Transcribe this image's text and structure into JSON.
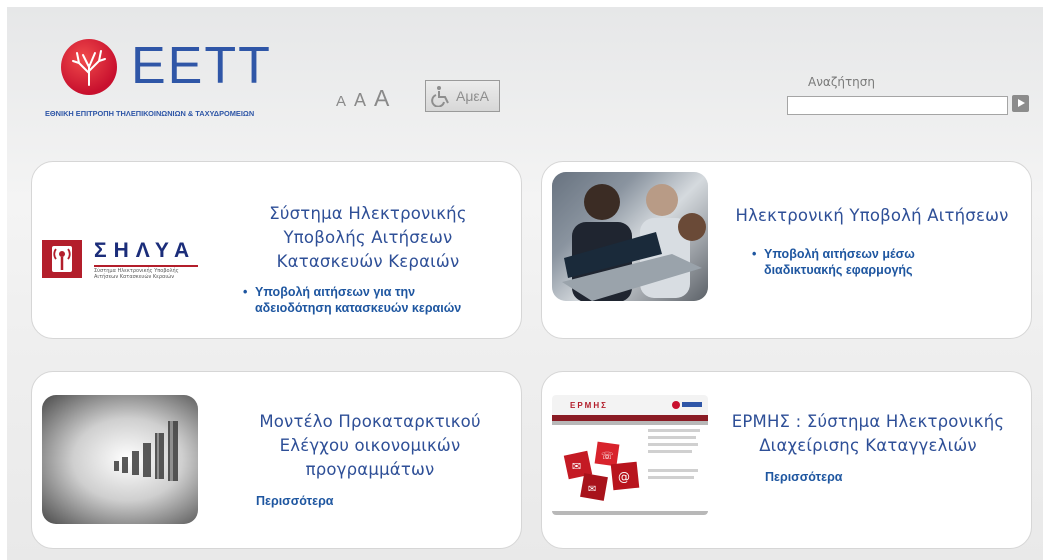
{
  "header": {
    "logo_text": "ΕΕΤΤ",
    "logo_subtitle": "ΕΘΝΙΚΗ ΕΠΙΤΡΟΠΗ ΤΗΛΕΠΙΚΟΙΝΩΝΙΩΝ & ΤΑΧΥΔΡΟΜΕΙΩΝ",
    "font_small": "A",
    "font_medium": "A",
    "font_large": "A",
    "amea_label": "ΑμεΑ",
    "search_label": "Αναζήτηση",
    "search_value": "",
    "accent_color": "#2f56a7",
    "brand_red": "#c8102e"
  },
  "cards": [
    {
      "logo_title": "ΣΗΛΥΑ",
      "logo_subtitle": "Σύστημα Ηλεκτρονικής Υποβολής Αιτήσεων Κατασκευών Κεραιών",
      "title_lines": [
        "Σύστημα Ηλεκτρονικής",
        "Υποβολής Αιτήσεων",
        "Κατασκευών Κεραιών"
      ],
      "bullet_lines": [
        "Υποβολή αιτήσεων για την",
        "αδειοδότηση κατασκευών κεραιών"
      ]
    },
    {
      "title_lines": [
        "Ηλεκτρονική Υποβολή Αιτήσεων"
      ],
      "bullet_lines": [
        "Υποβολή αιτήσεων μέσω",
        "διαδικτυακής εφαρμογής"
      ]
    },
    {
      "title_lines": [
        "Μοντέλο Προκαταρκτικού",
        "Ελέγχου οικονομικών",
        "προγραμμάτων"
      ],
      "more_label": "Περισσότερα"
    },
    {
      "image_title": "ΕΡΜΗΣ",
      "title_lines": [
        "ΕΡΜΗΣ : Σύστημα Ηλεκτρονικής",
        "Διαχείρισης Καταγγελιών"
      ],
      "more_label": "Περισσότερα"
    }
  ]
}
